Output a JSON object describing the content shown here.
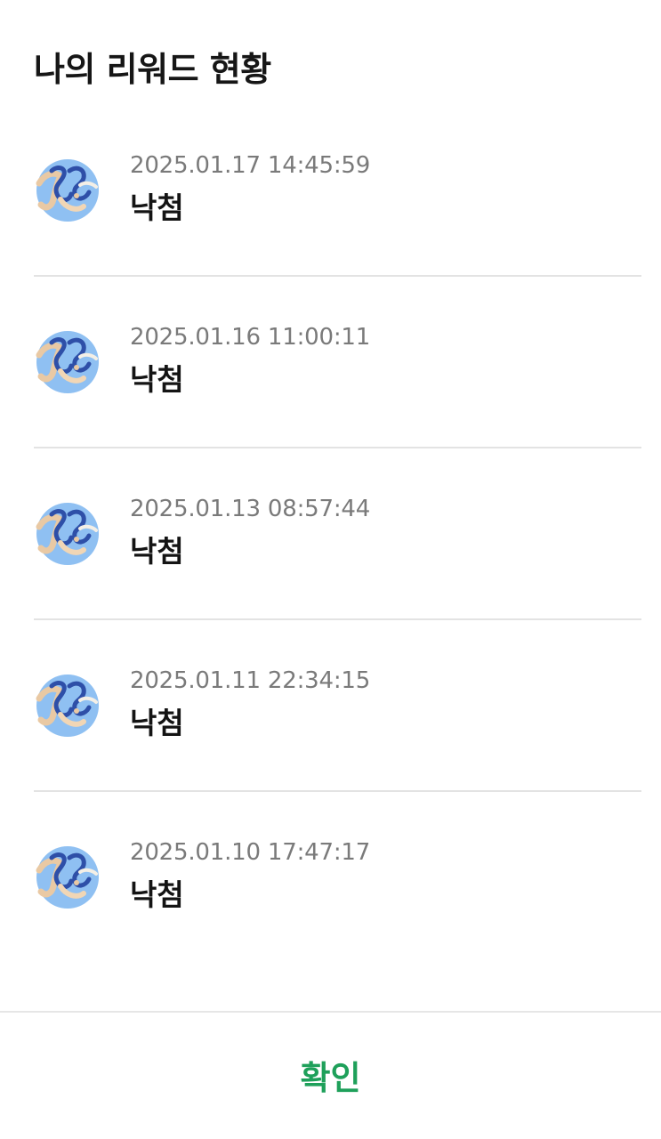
{
  "header": {
    "title": "나의 리워드 현황"
  },
  "rewards": [
    {
      "date": "2025.01.17 14:45:59",
      "result": "낙첨",
      "icon": "reward-character-icon"
    },
    {
      "date": "2025.01.16 11:00:11",
      "result": "낙첨",
      "icon": "reward-character-icon"
    },
    {
      "date": "2025.01.13 08:57:44",
      "result": "낙첨",
      "icon": "reward-character-icon"
    },
    {
      "date": "2025.01.11 22:34:15",
      "result": "낙첨",
      "icon": "reward-character-icon"
    },
    {
      "date": "2025.01.10 17:47:17",
      "result": "낙첨",
      "icon": "reward-character-icon"
    }
  ],
  "footer": {
    "confirm_label": "확인"
  },
  "colors": {
    "accent": "#1ea05a",
    "avatar_bg": "#8fc0f2",
    "divider": "#e3e3e3",
    "date_text": "#7a7a7a"
  }
}
